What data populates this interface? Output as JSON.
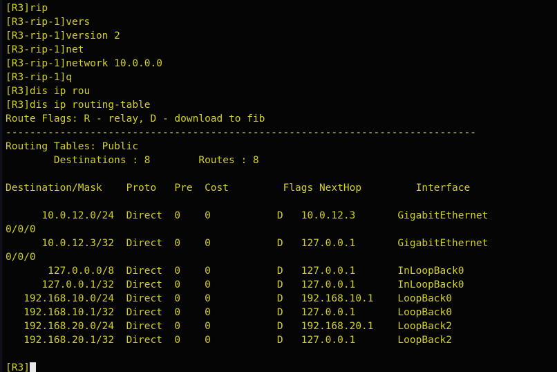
{
  "terminal": {
    "app": "network-device-cli",
    "colors": {
      "background": "#050505",
      "text": "#d2d028",
      "cursor": "#e8e8e8",
      "left_edge": "#131524"
    },
    "prompt_device": "R3",
    "cursor_visible": true
  },
  "session": {
    "commands": [
      "[R3]rip",
      "[R3-rip-1]vers",
      "[R3-rip-1]version 2",
      "[R3-rip-1]net",
      "[R3-rip-1]network 10.0.0.0",
      "[R3-rip-1]q",
      "[R3]dis ip rou",
      "[R3]dis ip routing-table"
    ],
    "route_flags_line": "Route Flags: R - relay, D - download to fib",
    "separator": "------------------------------------------------------------------------------",
    "routing_tables_label": "Routing Tables: Public",
    "summary": {
      "destinations_label": "Destinations",
      "destinations_value": "8",
      "routes_label": "Routes",
      "routes_value": "8",
      "line": "        Destinations : 8        Routes : 8"
    },
    "final_prompt": "[R3]"
  },
  "routing_table": {
    "headers": [
      "Destination/Mask",
      "Proto",
      "Pre",
      "Cost",
      "Flags",
      "NextHop",
      "Interface"
    ],
    "header_line": "Destination/Mask    Proto   Pre  Cost         Flags NextHop         Interface",
    "rows": [
      {
        "destination_mask": "10.0.12.0/24",
        "proto": "Direct",
        "pre": "0",
        "cost": "0",
        "flags": "D",
        "nexthop": "10.0.12.3",
        "interface": "GigabitEthernet",
        "interface_wrap": "0/0/0",
        "line": "      10.0.12.0/24  Direct  0    0           D   10.0.12.3       GigabitEthernet",
        "wrap_line": "0/0/0"
      },
      {
        "destination_mask": "10.0.12.3/32",
        "proto": "Direct",
        "pre": "0",
        "cost": "0",
        "flags": "D",
        "nexthop": "127.0.0.1",
        "interface": "GigabitEthernet",
        "interface_wrap": "0/0/0",
        "line": "      10.0.12.3/32  Direct  0    0           D   127.0.0.1       GigabitEthernet",
        "wrap_line": "0/0/0"
      },
      {
        "destination_mask": "127.0.0.0/8",
        "proto": "Direct",
        "pre": "0",
        "cost": "0",
        "flags": "D",
        "nexthop": "127.0.0.1",
        "interface": "InLoopBack0",
        "interface_wrap": "",
        "line": "       127.0.0.0/8  Direct  0    0           D   127.0.0.1       InLoopBack0",
        "wrap_line": ""
      },
      {
        "destination_mask": "127.0.0.1/32",
        "proto": "Direct",
        "pre": "0",
        "cost": "0",
        "flags": "D",
        "nexthop": "127.0.0.1",
        "interface": "InLoopBack0",
        "interface_wrap": "",
        "line": "      127.0.0.1/32  Direct  0    0           D   127.0.0.1       InLoopBack0",
        "wrap_line": ""
      },
      {
        "destination_mask": "192.168.10.0/24",
        "proto": "Direct",
        "pre": "0",
        "cost": "0",
        "flags": "D",
        "nexthop": "192.168.10.1",
        "interface": "LoopBack0",
        "interface_wrap": "",
        "line": "   192.168.10.0/24  Direct  0    0           D   192.168.10.1    LoopBack0",
        "wrap_line": ""
      },
      {
        "destination_mask": "192.168.10.1/32",
        "proto": "Direct",
        "pre": "0",
        "cost": "0",
        "flags": "D",
        "nexthop": "127.0.0.1",
        "interface": "LoopBack0",
        "interface_wrap": "",
        "line": "   192.168.10.1/32  Direct  0    0           D   127.0.0.1       LoopBack0",
        "wrap_line": ""
      },
      {
        "destination_mask": "192.168.20.0/24",
        "proto": "Direct",
        "pre": "0",
        "cost": "0",
        "flags": "D",
        "nexthop": "192.168.20.1",
        "interface": "LoopBack2",
        "interface_wrap": "",
        "line": "   192.168.20.0/24  Direct  0    0           D   192.168.20.1    LoopBack2",
        "wrap_line": ""
      },
      {
        "destination_mask": "192.168.20.1/32",
        "proto": "Direct",
        "pre": "0",
        "cost": "0",
        "flags": "D",
        "nexthop": "127.0.0.1",
        "interface": "LoopBack2",
        "interface_wrap": "",
        "line": "   192.168.20.1/32  Direct  0    0           D   127.0.0.1       LoopBack2",
        "wrap_line": ""
      }
    ]
  }
}
